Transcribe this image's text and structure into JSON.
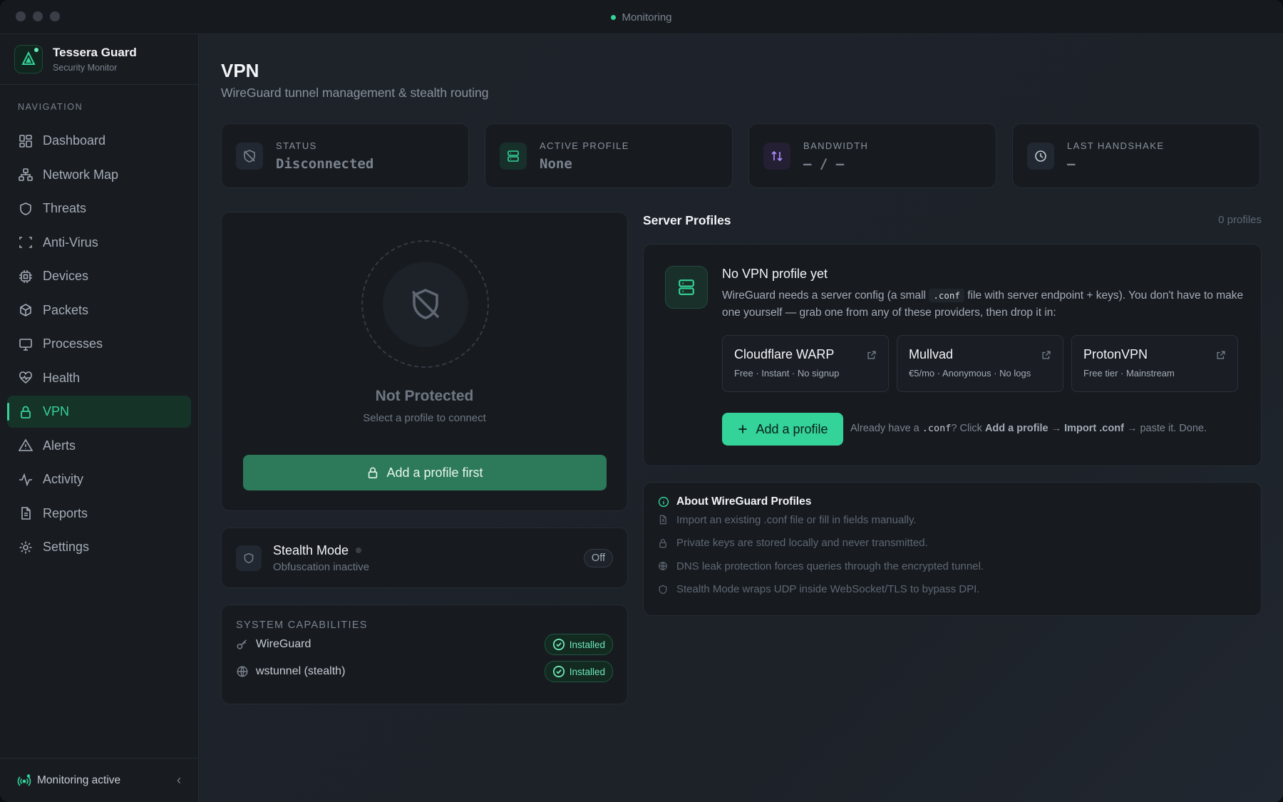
{
  "window": {
    "title": "Monitoring",
    "title_dot_color": "#34d399"
  },
  "brand": {
    "name": "Tessera Guard",
    "subtitle": "Security Monitor",
    "icon": "shield-logo-icon"
  },
  "nav": {
    "label": "NAVIGATION",
    "items": [
      {
        "label": "Dashboard",
        "icon": "dashboard-icon"
      },
      {
        "label": "Network Map",
        "icon": "network-icon"
      },
      {
        "label": "Threats",
        "icon": "shield-icon"
      },
      {
        "label": "Anti-Virus",
        "icon": "scan-icon"
      },
      {
        "label": "Devices",
        "icon": "chip-icon"
      },
      {
        "label": "Packets",
        "icon": "package-icon"
      },
      {
        "label": "Processes",
        "icon": "monitor-icon"
      },
      {
        "label": "Health",
        "icon": "heart-pulse-icon"
      },
      {
        "label": "VPN",
        "icon": "lock-icon",
        "active": true
      },
      {
        "label": "Alerts",
        "icon": "warning-icon"
      },
      {
        "label": "Activity",
        "icon": "activity-icon"
      },
      {
        "label": "Reports",
        "icon": "document-icon"
      },
      {
        "label": "Settings",
        "icon": "gear-icon"
      }
    ],
    "active_color": "#34d399"
  },
  "footer": {
    "status": "Monitoring active",
    "collapse_icon": "chevron-left-icon"
  },
  "page": {
    "title": "VPN",
    "subtitle": "WireGuard tunnel management & stealth routing"
  },
  "stats": [
    {
      "label": "STATUS",
      "value": "Disconnected",
      "icon": "shield-off-icon"
    },
    {
      "label": "ACTIVE PROFILE",
      "value": "None",
      "icon": "server-icon"
    },
    {
      "label": "BANDWIDTH",
      "value": "— / —",
      "icon": "arrows-up-down-icon"
    },
    {
      "label": "LAST HANDSHAKE",
      "value": "—",
      "icon": "clock-icon"
    }
  ],
  "hero": {
    "title": "Not Protected",
    "subtitle": "Select a profile to connect",
    "button": "Add a profile first"
  },
  "stealth": {
    "title": "Stealth Mode",
    "subtitle": "Obfuscation inactive",
    "state": "Off"
  },
  "capabilities": {
    "title": "SYSTEM CAPABILITIES",
    "items": [
      {
        "name": "WireGuard",
        "status": "Installed",
        "icon": "key-icon"
      },
      {
        "name": "wstunnel (stealth)",
        "status": "Installed",
        "icon": "globe-icon"
      }
    ]
  },
  "profiles": {
    "title": "Server Profiles",
    "count": "0 profiles",
    "empty_title": "No VPN profile yet",
    "empty_desc_1": "WireGuard needs a server config (a small",
    "empty_desc_code": ".conf",
    "empty_desc_2": "file with server endpoint + keys). You don't have to make one yourself — grab one from any of these providers, then drop it in:",
    "providers": [
      {
        "name": "Cloudflare WARP",
        "desc": "Free · Instant · No signup"
      },
      {
        "name": "Mullvad",
        "desc": "€5/mo · Anonymous · No logs"
      },
      {
        "name": "ProtonVPN",
        "desc": "Free tier · Mainstream"
      }
    ],
    "add_button": "Add a profile",
    "hint_1": "Already have a",
    "hint_code": ".conf",
    "hint_2": "? Click",
    "hint_b1": "Add a profile",
    "hint_arrow1": "→",
    "hint_b2": "Import .conf",
    "hint_3": "→ paste it. Done."
  },
  "about": {
    "title": "About WireGuard Profiles",
    "items": [
      {
        "text": "Import an existing .conf file or fill in fields manually.",
        "icon": "file-icon"
      },
      {
        "text": "Private keys are stored locally and never transmitted.",
        "icon": "lock-icon"
      },
      {
        "text": "DNS leak protection forces queries through the encrypted tunnel.",
        "icon": "globe-icon"
      },
      {
        "text": "Stealth Mode wraps UDP inside WebSocket/TLS to bypass DPI.",
        "icon": "shield-icon"
      }
    ]
  }
}
